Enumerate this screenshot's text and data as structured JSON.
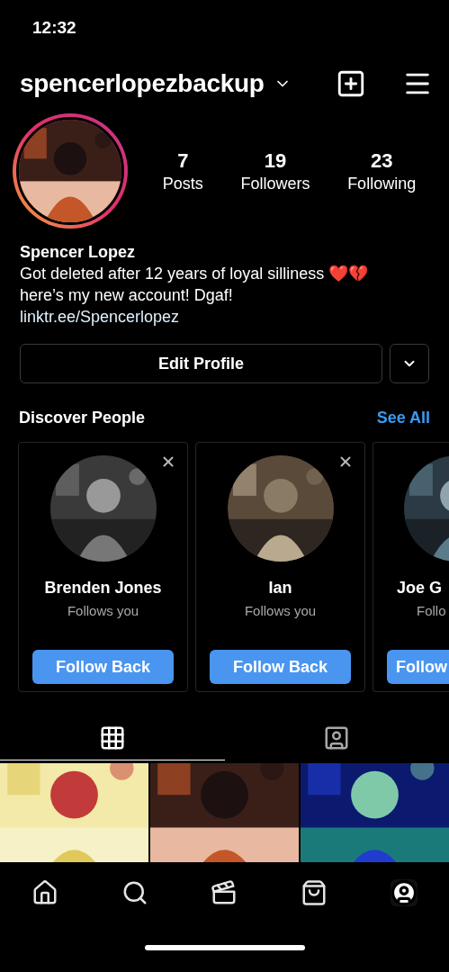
{
  "status_bar": {
    "time": "12:32"
  },
  "header": {
    "username": "spencerlopezbackup"
  },
  "profile": {
    "has_story": true,
    "stats": [
      {
        "value": "7",
        "label": "Posts"
      },
      {
        "value": "19",
        "label": "Followers"
      },
      {
        "value": "23",
        "label": "Following"
      }
    ],
    "name": "Spencer Lopez",
    "bio": "Got deleted after 12 years of loyal silliness ❤️💔\nhere’s my new account! Dgaf!",
    "link": "linktr.ee/Spencerlopez"
  },
  "actions": {
    "edit_button": "Edit Profile"
  },
  "discover": {
    "title": "Discover People",
    "see_all": "See All",
    "cards": [
      {
        "kind": "full",
        "name": "Brenden Jones",
        "subtitle": "Follows you",
        "button": "Follow Back"
      },
      {
        "kind": "full",
        "name": "Ian",
        "subtitle": "Follows you",
        "button": "Follow Back"
      },
      {
        "kind": "partial",
        "name": "Joe G",
        "subtitle": "Follo",
        "button": "Follow"
      }
    ]
  },
  "tabs": [
    {
      "kind": "grid",
      "selected": true
    },
    {
      "kind": "tagged",
      "selected": false
    }
  ],
  "nav": [
    {
      "kind": "home",
      "selected": false
    },
    {
      "kind": "search",
      "selected": false
    },
    {
      "kind": "reels",
      "selected": false
    },
    {
      "kind": "shop",
      "selected": false
    },
    {
      "kind": "profile",
      "selected": true
    }
  ]
}
